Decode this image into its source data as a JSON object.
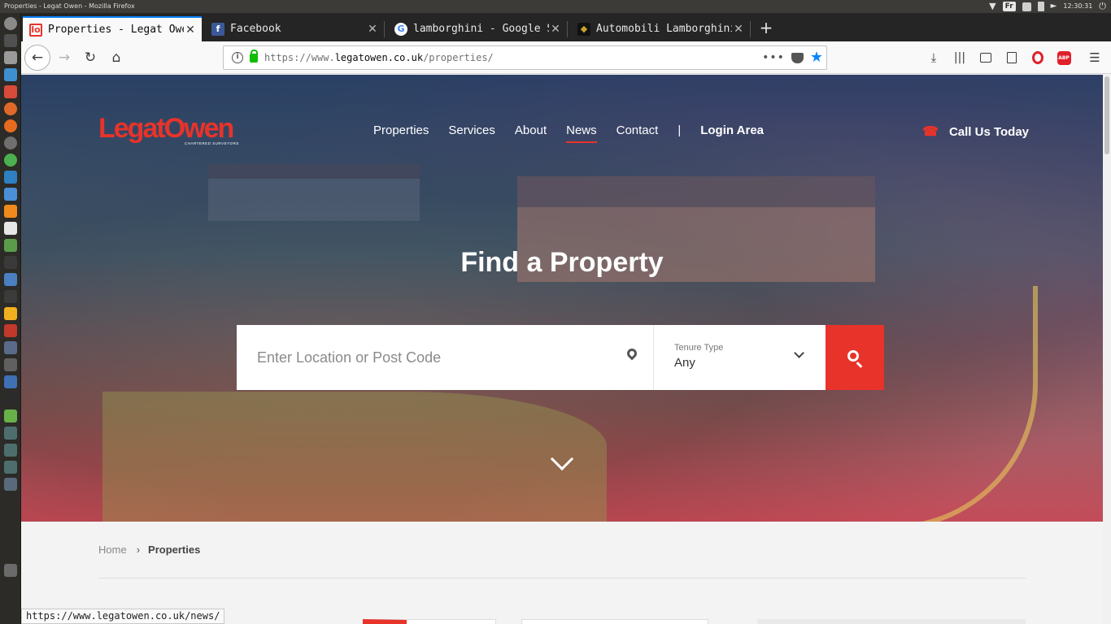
{
  "os": {
    "window_title": "Properties - Legat Owen - Mozilla Firefox",
    "keyboard_layout": "Fr",
    "clock": "12:30:31"
  },
  "tabs": [
    {
      "label": "Properties - Legat Owen",
      "favicon": "legatowen-favicon",
      "active": true
    },
    {
      "label": "Facebook",
      "favicon": "facebook-favicon",
      "active": false
    },
    {
      "label": "lamborghini - Google Search",
      "favicon": "google-favicon",
      "active": false
    },
    {
      "label": "Automobili Lamborghini",
      "favicon": "lamborghini-favicon",
      "active": false
    }
  ],
  "urlbar": {
    "prefix": "https://www.",
    "host": "legatowen.co.uk",
    "path": "/properties/"
  },
  "site": {
    "logo_text": "LegatOwen",
    "logo_subtext": "CHARTERED SURVEYORS",
    "nav": [
      "Properties",
      "Services",
      "About",
      "News",
      "Contact"
    ],
    "nav_active": "News",
    "nav_separator": "|",
    "login": "Login Area",
    "call": "Call Us Today",
    "accent": "#e8332a"
  },
  "hero": {
    "title": "Find a Property",
    "search_placeholder": "Enter Location or Post Code",
    "tenure_label": "Tenure Type",
    "tenure_value": "Any"
  },
  "breadcrumb": {
    "home": "Home",
    "current": "Properties"
  },
  "status_url": "https://www.legatowen.co.uk/news/"
}
